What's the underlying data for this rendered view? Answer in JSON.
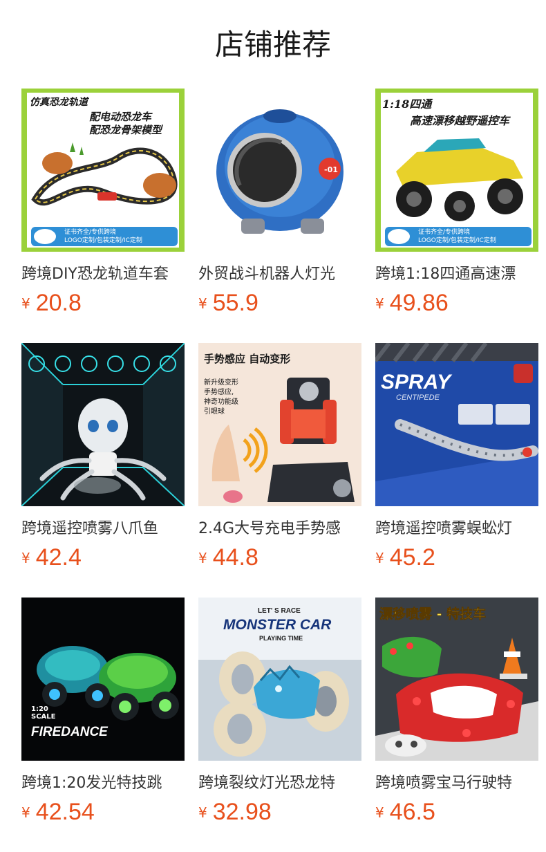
{
  "title": "店铺推荐",
  "currency": "¥",
  "products": [
    {
      "name": "跨境DIY恐龙轨道车套",
      "price": "20.8",
      "img_text": [
        "仿真恐龙轨道",
        "配电动恐龙车",
        "配恐龙骨架模型",
        "证书齐全/专供跨境",
        "LOGO定制/包装定制/IC定制"
      ]
    },
    {
      "name": "外贸战斗机器人灯光",
      "price": "55.9",
      "img_text": [
        "-01"
      ]
    },
    {
      "name": "跨境1:18四通高速漂",
      "price": "49.86",
      "img_text": [
        "1:18四通",
        "高速漂移越野遥控车",
        "证书齐全/专供跨境",
        "LOGO定制/包装定制/IC定制"
      ]
    },
    {
      "name": "跨境遥控喷雾八爪鱼",
      "price": "42.4",
      "img_text": []
    },
    {
      "name": "2.4G大号充电手势感",
      "price": "44.8",
      "img_text": [
        "手势感应 自动变形",
        "新升级变形",
        "手势感应,",
        "神奇功能级",
        "引眼球"
      ]
    },
    {
      "name": "跨境遥控喷雾蜈蚣灯",
      "price": "45.2",
      "img_text": [
        "SPRAY",
        "CENTIPEDE"
      ]
    },
    {
      "name": "跨境1:20发光特技跳",
      "price": "42.54",
      "img_text": [
        "1:20",
        "SCALE",
        "FIREDANCE"
      ]
    },
    {
      "name": "跨境裂纹灯光恐龙特",
      "price": "32.98",
      "img_text": [
        "LET' S RACE",
        "MONSTER CAR",
        "PLAYING TIME"
      ]
    },
    {
      "name": "跨境喷雾宝马行驶特",
      "price": "46.5",
      "img_text": [
        "漂移喷雾 - 特技车"
      ]
    }
  ]
}
